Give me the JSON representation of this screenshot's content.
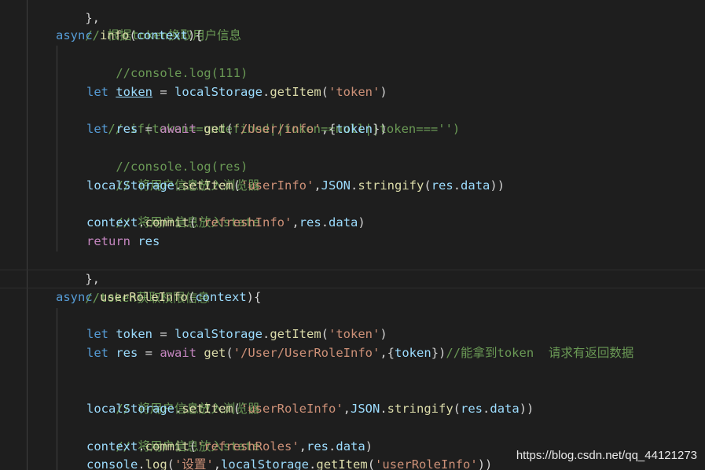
{
  "code": {
    "line_0": "},",
    "line_1": "// 根据token换取用户信息",
    "line_2_kw": "async",
    "line_2_fn": "info",
    "line_2_rest_open": "(",
    "line_2_param": "context",
    "line_2_rest_close": "){",
    "line_3": "//console.log(111)",
    "line_5_kw": "let",
    "line_5_var": "token",
    "line_5_eq": " = ",
    "line_5_obj": "localStorage",
    "line_5_dot": ".",
    "line_5_fn": "getItem",
    "line_5_open": "(",
    "line_5_str": "'token'",
    "line_5_close": ")",
    "line_6": "// if(token==undefined||token==null||token==='')",
    "line_7_kw": "let",
    "line_7_var": "res",
    "line_7_eq": " = ",
    "line_7_await": "await",
    "line_7_fn": "get",
    "line_7_open": "(",
    "line_7_str": "'/User/info'",
    "line_7_comma": ",{",
    "line_7_arg": "token",
    "line_7_close": "})",
    "line_8": "//console.log(res)",
    "line_9": "// 将用户信息放入浏览器",
    "line_10_obj": "localStorage",
    "line_10_dot": ".",
    "line_10_fn": "setItem",
    "line_10_open": "(",
    "line_10_str": "'userInfo'",
    "line_10_comma": ",",
    "line_10_json": "JSON",
    "line_10_dot2": ".",
    "line_10_fn2": "stringify",
    "line_10_open2": "(",
    "line_10_res": "res",
    "line_10_dot3": ".",
    "line_10_data": "data",
    "line_10_close": "))",
    "line_11": "// 将用户信息放入state",
    "line_12_obj": "context",
    "line_12_dot": ".",
    "line_12_fn": "commit",
    "line_12_open": "(",
    "line_12_str": "'refreshInfo'",
    "line_12_comma": ",",
    "line_12_res": "res",
    "line_12_dot2": ".",
    "line_12_data": "data",
    "line_12_close": ")",
    "line_13_kw": "return",
    "line_13_var": "res",
    "line_14": "},",
    "line_15": "//token获取权限信息",
    "line_16_kw": "async",
    "line_16_fn": "userRoleInfo",
    "line_16_open": "(",
    "line_16_param": "context",
    "line_16_close": "){",
    "line_18_kw": "let",
    "line_18_var": "token",
    "line_18_eq": " = ",
    "line_18_obj": "localStorage",
    "line_18_dot": ".",
    "line_18_fn": "getItem",
    "line_18_open": "(",
    "line_18_str": "'token'",
    "line_18_close": ")",
    "line_19_kw": "let",
    "line_19_var": "res",
    "line_19_eq": " = ",
    "line_19_await": "await",
    "line_19_fn": "get",
    "line_19_open": "(",
    "line_19_str": "'/User/UserRoleInfo'",
    "line_19_comma": ",{",
    "line_19_arg": "token",
    "line_19_close": "})",
    "line_19_comment": "//能拿到token  请求有返回数据",
    "line_21": "// 将用户信息放入浏览器",
    "line_22_obj": "localStorage",
    "line_22_dot": ".",
    "line_22_fn": "setItem",
    "line_22_open": "(",
    "line_22_str": "'userRoleInfo'",
    "line_22_comma": ",",
    "line_22_json": "JSON",
    "line_22_dot2": ".",
    "line_22_fn2": "stringify",
    "line_22_open2": "(",
    "line_22_res": "res",
    "line_22_dot3": ".",
    "line_22_data": "data",
    "line_22_close": "))",
    "line_23": "// 将用户信息放入state",
    "line_24_obj": "context",
    "line_24_dot": ".",
    "line_24_fn": "commit",
    "line_24_open": "(",
    "line_24_str": "'refreshRoles'",
    "line_24_comma": ",",
    "line_24_res": "res",
    "line_24_dot2": ".",
    "line_24_data": "data",
    "line_24_close": ")",
    "line_25_obj": "console",
    "line_25_dot": ".",
    "line_25_fn": "log",
    "line_25_open": "(",
    "line_25_str": "'设置'",
    "line_25_comma": ",",
    "line_25_obj2": "localStorage",
    "line_25_dot2": ".",
    "line_25_fn2": "getItem",
    "line_25_open2": "(",
    "line_25_str2": "'userRoleInfo'",
    "line_25_close": "))"
  },
  "watermark": "https://blog.csdn.net/qq_44121273",
  "colors": {
    "background": "#1e1e1e",
    "keyword": "#569cd6",
    "function": "#dcdcaa",
    "variable": "#9cdcfe",
    "string": "#ce9178",
    "comment": "#6a9955",
    "control": "#c586c0",
    "class": "#4ec9b0"
  }
}
